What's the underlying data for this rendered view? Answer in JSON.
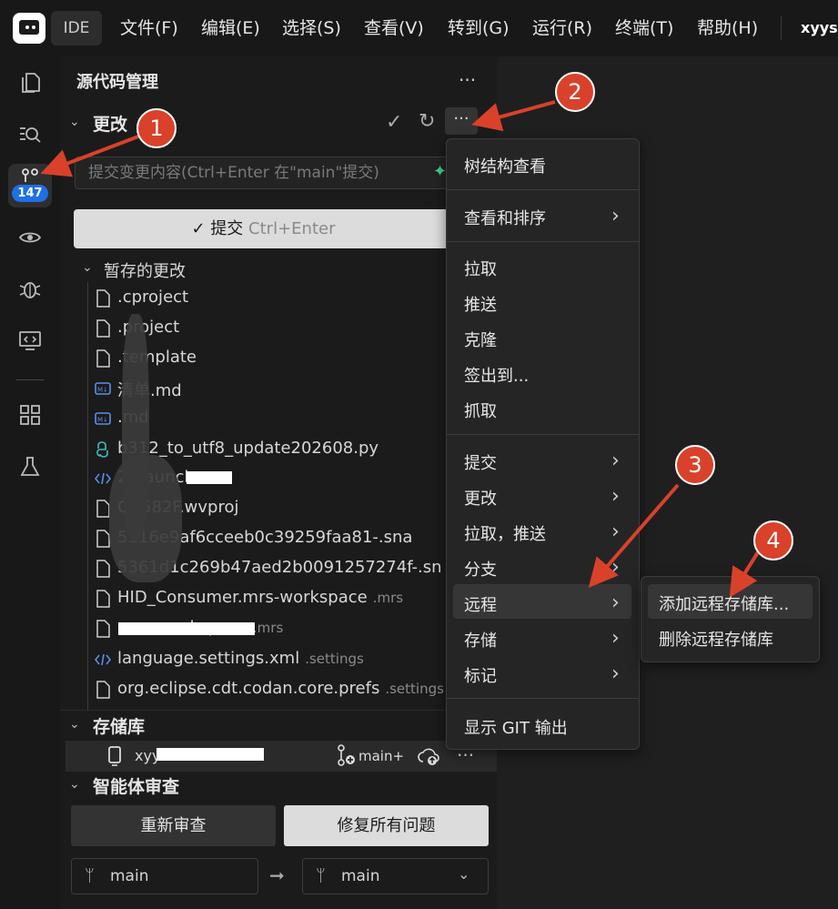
{
  "app": {
    "name": "IDE",
    "user": "xyysh"
  },
  "menu": [
    "文件(F)",
    "编辑(E)",
    "选择(S)",
    "查看(V)",
    "转到(G)",
    "运行(R)",
    "终端(T)",
    "帮助(H)"
  ],
  "activity": {
    "scm_badge": "147"
  },
  "sidebar": {
    "title": "源代码管理",
    "more": "···",
    "changes": {
      "label": "更改",
      "commit_placeholder": "提交变更内容(Ctrl+Enter 在\"main\"提交)",
      "commit_button": "提交",
      "commit_shortcut": "Ctrl+Enter",
      "staged_label": "暂存的更改",
      "files": [
        {
          "name": ".cproject",
          "folder": "",
          "icon": "file-icon"
        },
        {
          "name": ".project",
          "folder": "",
          "icon": "file-icon"
        },
        {
          "name": ".template",
          "folder": "",
          "icon": "file-icon"
        },
        {
          "name": "清单.md",
          "folder": "",
          "icon": "markdown-icon"
        },
        {
          "name": ".md",
          "folder": "",
          "icon": "markdown-icon"
        },
        {
          "name": "b312_to_utf8_update202608.py",
          "folder": "",
          "icon": "python-icon"
        },
        {
          "name": "2F.launch",
          "folder": "",
          "icon": "code-icon"
        },
        {
          "name": "CH582F.wvproj",
          "folder": "",
          "icon": "file-icon"
        },
        {
          "name": "5116e9af6cceeb0c39259faa81-.sna",
          "folder": "",
          "icon": "file-icon"
        },
        {
          "name": "5361d1c269b47aed2b0091257274f-.sn",
          "folder": "",
          "icon": "file-icon"
        },
        {
          "name": "HID_Consumer.mrs-workspace",
          "folder": ".mrs",
          "icon": "file-icon"
        },
        {
          "name": ".mrs-workspace",
          "folder": ".mrs",
          "icon": "file-icon"
        },
        {
          "name": "language.settings.xml",
          "folder": ".settings",
          "icon": "code-icon"
        },
        {
          "name": "org.eclipse.cdt.codan.core.prefs",
          "folder": ".settings",
          "icon": "file-icon"
        }
      ]
    },
    "repo": {
      "label": "存储库",
      "name": "xyy",
      "branch": "main+"
    },
    "agent": {
      "label": "智能体审查",
      "rereview": "重新审查",
      "fix_all": "修复所有问题",
      "from_branch": "main",
      "to_branch": "main"
    }
  },
  "context_menu": {
    "items": [
      "树结构查看",
      "查看和排序",
      "拉取",
      "推送",
      "克隆",
      "签出到...",
      "抓取",
      "提交",
      "更改",
      "拉取，推送",
      "分支",
      "远程",
      "存储",
      "标记",
      "显示 GIT 输出"
    ],
    "submenu": [
      "添加远程存储库...",
      "删除远程存储库"
    ]
  },
  "callouts": [
    "1",
    "2",
    "3",
    "4"
  ],
  "colors": {
    "accent": "#1f6fe5",
    "callout": "#d9412a"
  }
}
